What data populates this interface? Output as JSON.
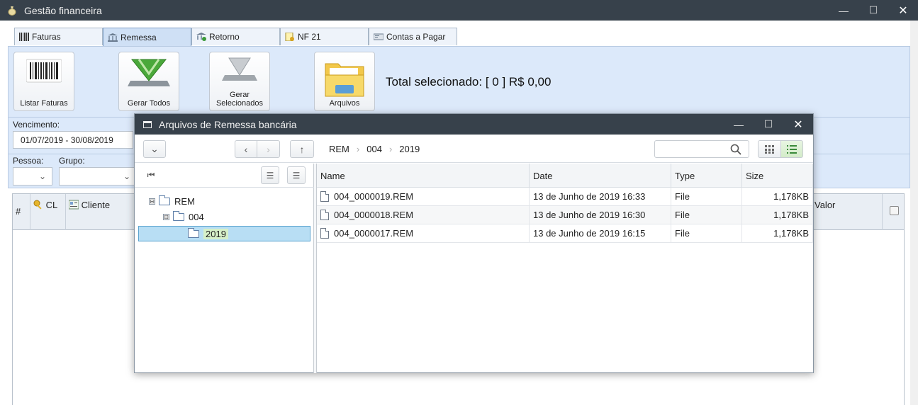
{
  "window": {
    "title": "Gestão financeira",
    "minimize": "—",
    "maximize": "☐",
    "close": "✕"
  },
  "tabs": [
    {
      "label": "Faturas",
      "icon": "barcode-icon"
    },
    {
      "label": "Remessa",
      "icon": "bank-icon"
    },
    {
      "label": "Retorno",
      "icon": "bank-return-icon"
    },
    {
      "label": "NF 21",
      "icon": "invoice-icon"
    },
    {
      "label": "Contas a Pagar",
      "icon": "bill-icon"
    }
  ],
  "toolbar": {
    "listar": "Listar Faturas",
    "gerar_todos": "Gerar Todos",
    "gerar_sel_1": "Gerar",
    "gerar_sel_2": "Selecionados",
    "arquivos": "Arquivos",
    "total": "Total selecionado: [ 0 ] R$ 0,00"
  },
  "filters": {
    "vencimento_label": "Vencimento:",
    "vencimento_value": "01/07/2019 - 30/08/2019",
    "pessoa_label": "Pessoa:",
    "grupo_label": "Grupo:"
  },
  "grid": {
    "col_hash": "#",
    "col_cl": "CL",
    "col_cliente": "Cliente",
    "col_valor": "Valor"
  },
  "dialog": {
    "title": "Arquivos de Remessa bancária",
    "minimize": "—",
    "maximize": "☐",
    "close": "✕",
    "breadcrumb": [
      "REM",
      "004",
      "2019"
    ],
    "breadcrumb_sep": "›",
    "tree": [
      {
        "label": "REM",
        "toggle": "⊟"
      },
      {
        "label": "004",
        "toggle": "⊟"
      },
      {
        "label": "2019"
      }
    ],
    "columns": {
      "name": "Name",
      "date": "Date",
      "type": "Type",
      "size": "Size"
    },
    "files": [
      {
        "name": "004_0000019.REM",
        "date": "13 de Junho de 2019 16:33",
        "type": "File",
        "size": "1,178KB"
      },
      {
        "name": "004_0000018.REM",
        "date": "13 de Junho de 2019 16:30",
        "type": "File",
        "size": "1,178KB"
      },
      {
        "name": "004_0000017.REM",
        "date": "13 de Junho de 2019 16:15",
        "type": "File",
        "size": "1,178KB"
      }
    ]
  }
}
